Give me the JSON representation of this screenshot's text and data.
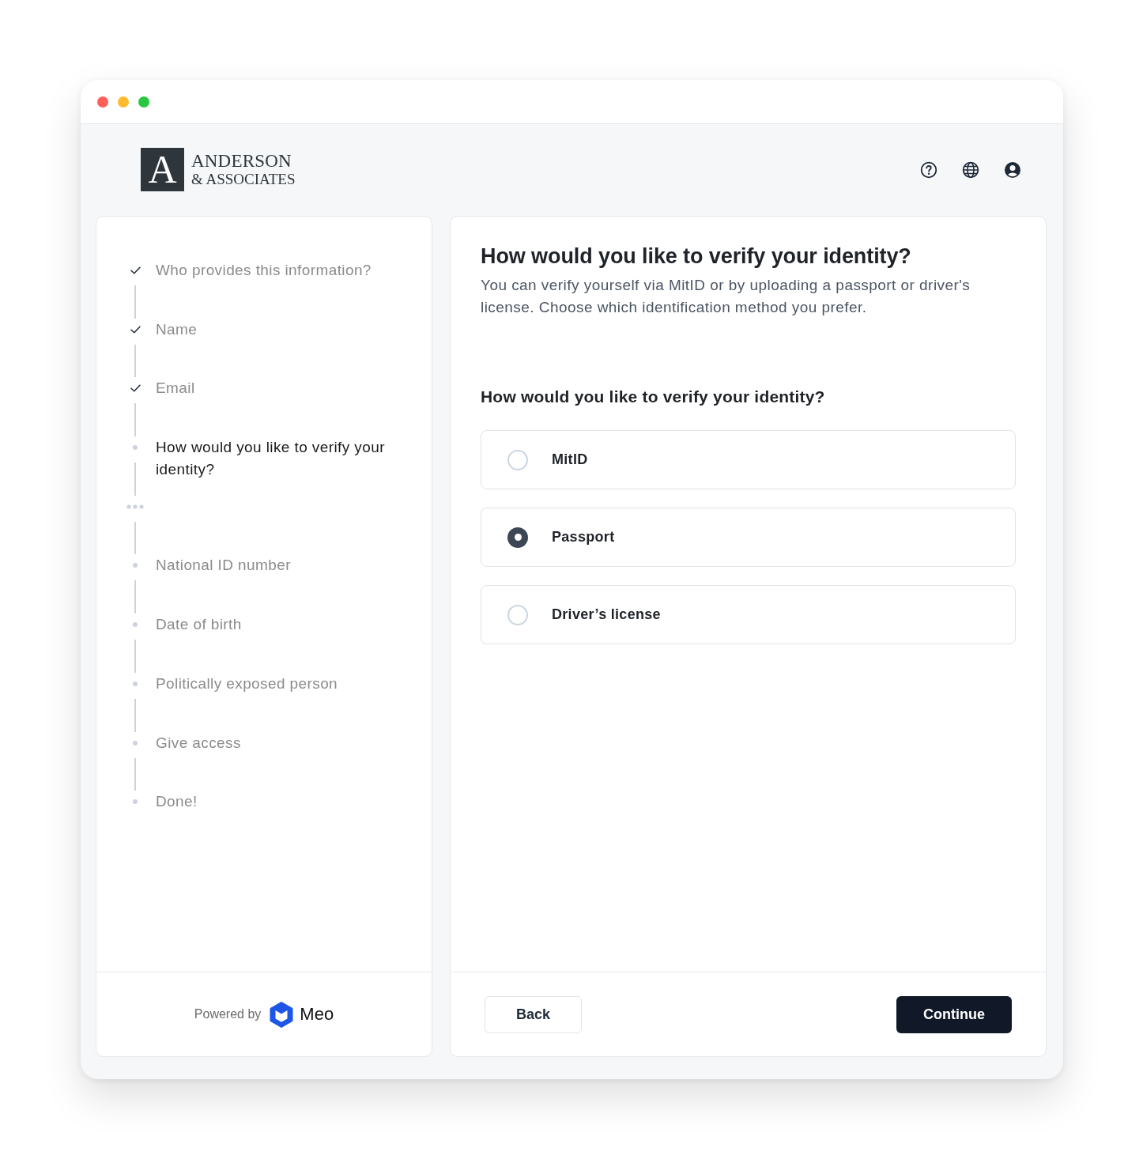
{
  "window": {
    "traffic_lights": [
      {
        "color": "#ff5f57"
      },
      {
        "color": "#febc2e"
      },
      {
        "color": "#28c840"
      }
    ]
  },
  "header": {
    "logo": {
      "letter": "A",
      "name": "ANDERSON",
      "tagline": "& ASSOCIATES"
    }
  },
  "steps": [
    {
      "label": "Who provides this information?",
      "kind": "completed"
    },
    {
      "label": "Name",
      "kind": "completed"
    },
    {
      "label": "Email",
      "kind": "completed"
    },
    {
      "label": "How would you like to verify your identity?",
      "kind": "current"
    },
    {
      "kind": "collapsed"
    },
    {
      "label": "National ID number",
      "kind": "upcoming"
    },
    {
      "label": "Date of birth",
      "kind": "upcoming"
    },
    {
      "label": "Politically exposed person",
      "kind": "upcoming"
    },
    {
      "label": "Give access",
      "kind": "upcoming"
    },
    {
      "label": "Done!",
      "kind": "upcoming"
    }
  ],
  "sidebar_footer": {
    "powered_by": "Powered by",
    "brand": "Meo"
  },
  "form": {
    "title": "How would you like to verify your identity?",
    "description": "You can verify yourself via MitID or by uploading a passport or driver's license. Choose which identification method you prefer.",
    "question": "How would you like to verify your identity?",
    "options": [
      {
        "label": "MitID",
        "selected": false
      },
      {
        "label": "Passport",
        "selected": true
      },
      {
        "label": "Driver’s license",
        "selected": false
      }
    ],
    "back_button": "Back",
    "continue_button": "Continue"
  }
}
